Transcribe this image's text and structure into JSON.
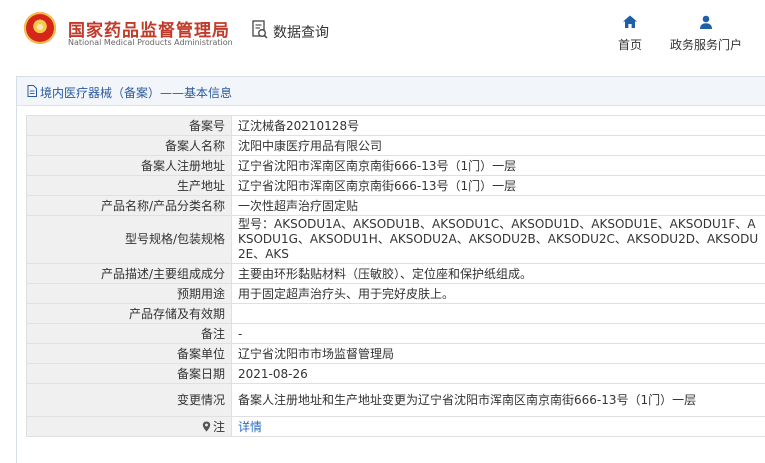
{
  "header": {
    "brand_cn": "国家药品监督管理局",
    "brand_en": "National Medical Products Administration",
    "query_label": "数据查询",
    "nav": {
      "home": "首页",
      "gov_service": "政务服务门户"
    }
  },
  "panel": {
    "title": "境内医疗器械（备案）——基本信息"
  },
  "rows": [
    {
      "label": "备案号",
      "value": "辽沈械备20210128号"
    },
    {
      "label": "备案人名称",
      "value": "沈阳中康医疗用品有限公司"
    },
    {
      "label": "备案人注册地址",
      "value": "辽宁省沈阳市浑南区南京南街666-13号（1门）一层"
    },
    {
      "label": "生产地址",
      "value": "辽宁省沈阳市浑南区南京南街666-13号（1门）一层"
    },
    {
      "label": "产品名称/产品分类名称",
      "value": "一次性超声治疗固定贴"
    },
    {
      "label": "型号规格/包装规格",
      "value": "型号：AKSODU1A、AKSODU1B、AKSODU1C、AKSODU1D、AKSODU1E、AKSODU1F、AKSODU1G、AKSODU1H、AKSODU2A、AKSODU2B、AKSODU2C、AKSODU2D、AKSODU2E、AKS"
    },
    {
      "label": "产品描述/主要组成成分",
      "value": "主要由环形黏贴材料（压敏胶）、定位座和保护纸组成。"
    },
    {
      "label": "预期用途",
      "value": "用于固定超声治疗头、用于完好皮肤上。"
    },
    {
      "label": "产品存储及有效期",
      "value": ""
    },
    {
      "label": "备注",
      "value": "-"
    },
    {
      "label": "备案单位",
      "value": "辽宁省沈阳市市场监督管理局"
    },
    {
      "label": "备案日期",
      "value": "2021-08-26"
    },
    {
      "label": "变更情况",
      "value": "备案人注册地址和生产地址变更为辽宁省沈阳市浑南区南京南街666-13号（1门）一层"
    },
    {
      "label": "注",
      "value": "详情"
    }
  ],
  "colors": {
    "brand_red": "#c23a2a",
    "link_blue": "#2b6cc4",
    "nav_blue": "#1f5fa8"
  },
  "icons": {
    "home": "home-icon",
    "user": "user-icon",
    "query": "search-doc-icon",
    "pin": "location-pin-icon"
  }
}
